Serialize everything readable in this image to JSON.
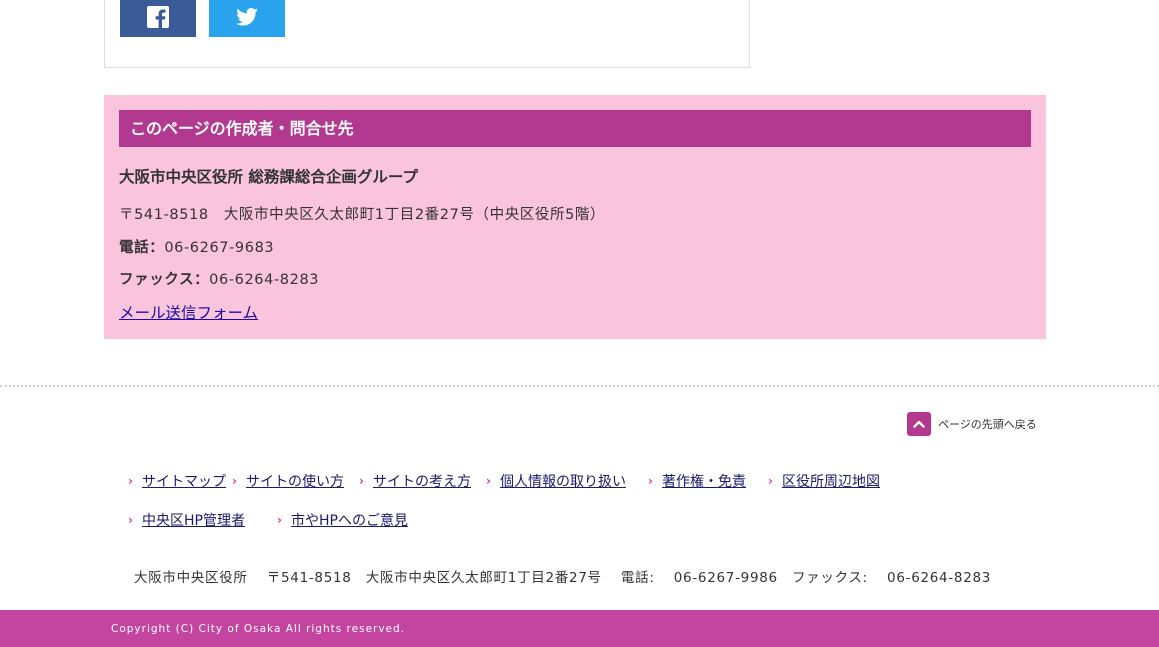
{
  "share": {
    "facebook_icon": "facebook-icon",
    "twitter_icon": "twitter-icon",
    "facebook_color": "#3b5a98",
    "twitter_color": "#2aa3ef"
  },
  "contact": {
    "heading": "このページの作成者・問合せ先",
    "organization": "大阪市中央区役所 総務課総合企画グループ",
    "address": "〒541-8518　大阪市中央区久太郎町1丁目2番27号（中央区役所5階）",
    "tel_label": "電話：",
    "tel_value": "06-6267-9683",
    "fax_label": "ファックス：",
    "fax_value": "06-6264-8283",
    "mail_link": "メール送信フォーム",
    "heading_color": "#b3388f",
    "background_color": "#fbc4dd"
  },
  "page_top": {
    "label": "ページの先頭へ戻る",
    "icon": "chevron-up-icon"
  },
  "footer_links": {
    "row1": [
      "サイトマップ",
      "サイトの使い方",
      "サイトの考え方",
      "個人情報の取り扱い",
      "著作権・免責",
      "区役所周辺地図"
    ],
    "row2": [
      "中央区HP管理者",
      "市やHPへのご意見"
    ]
  },
  "footer_address": "大阪市中央区役所　 〒541-8518　大阪市中央区久太郎町1丁目2番27号　 電話:　 06-6267-9986　ファックス:　 06-6264-8283",
  "copyright": "Copyright (C) City of Osaka All rights reserved.",
  "copyright_bar_color": "#c445a0"
}
